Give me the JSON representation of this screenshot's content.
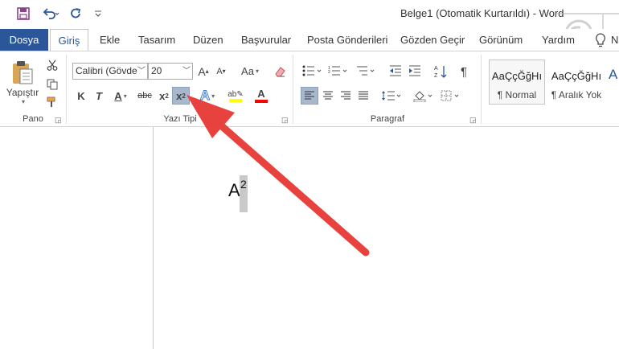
{
  "title_bar": {
    "title": "Belge1 (Otomatik Kurtarıldı)  -  Word"
  },
  "qat": {
    "save_icon": "save-icon",
    "undo_icon": "undo-icon",
    "redo_icon": "redo-icon",
    "customize_icon": "chevron-down-icon"
  },
  "tabs": [
    {
      "label": "Dosya"
    },
    {
      "label": "Giriş"
    },
    {
      "label": "Ekle"
    },
    {
      "label": "Tasarım"
    },
    {
      "label": "Düzen"
    },
    {
      "label": "Başvurular"
    },
    {
      "label": "Posta Gönderileri"
    },
    {
      "label": "Gözden Geçir"
    },
    {
      "label": "Görünüm"
    },
    {
      "label": "Yardım"
    }
  ],
  "ribbon": {
    "clipboard": {
      "paste_label": "Yapıştır",
      "group_label": "Pano"
    },
    "font": {
      "font_name": "Calibri (Gövde",
      "font_size": "20",
      "grow_label": "A",
      "shrink_label": "A",
      "case_label": "Aa",
      "bold": "K",
      "italic": "T",
      "underline": "A",
      "strike": "abc",
      "subscript": "x",
      "superscript": "x",
      "group_label": "Yazı Tipi"
    },
    "paragraph": {
      "group_label": "Paragraf"
    },
    "styles": {
      "items": [
        {
          "sample": "AaÇçĞğHı",
          "name": "¶ Normal"
        },
        {
          "sample": "AaÇçĞğHı",
          "name": "¶ Aralık Yok"
        }
      ],
      "partial_sample": "A"
    }
  },
  "document": {
    "text": "A",
    "superscript_text": "2"
  },
  "colors": {
    "brand": "#2b579a",
    "annotation_arrow": "#e8423f",
    "highlight": "#ffff00",
    "font_color": "#ff0000"
  }
}
